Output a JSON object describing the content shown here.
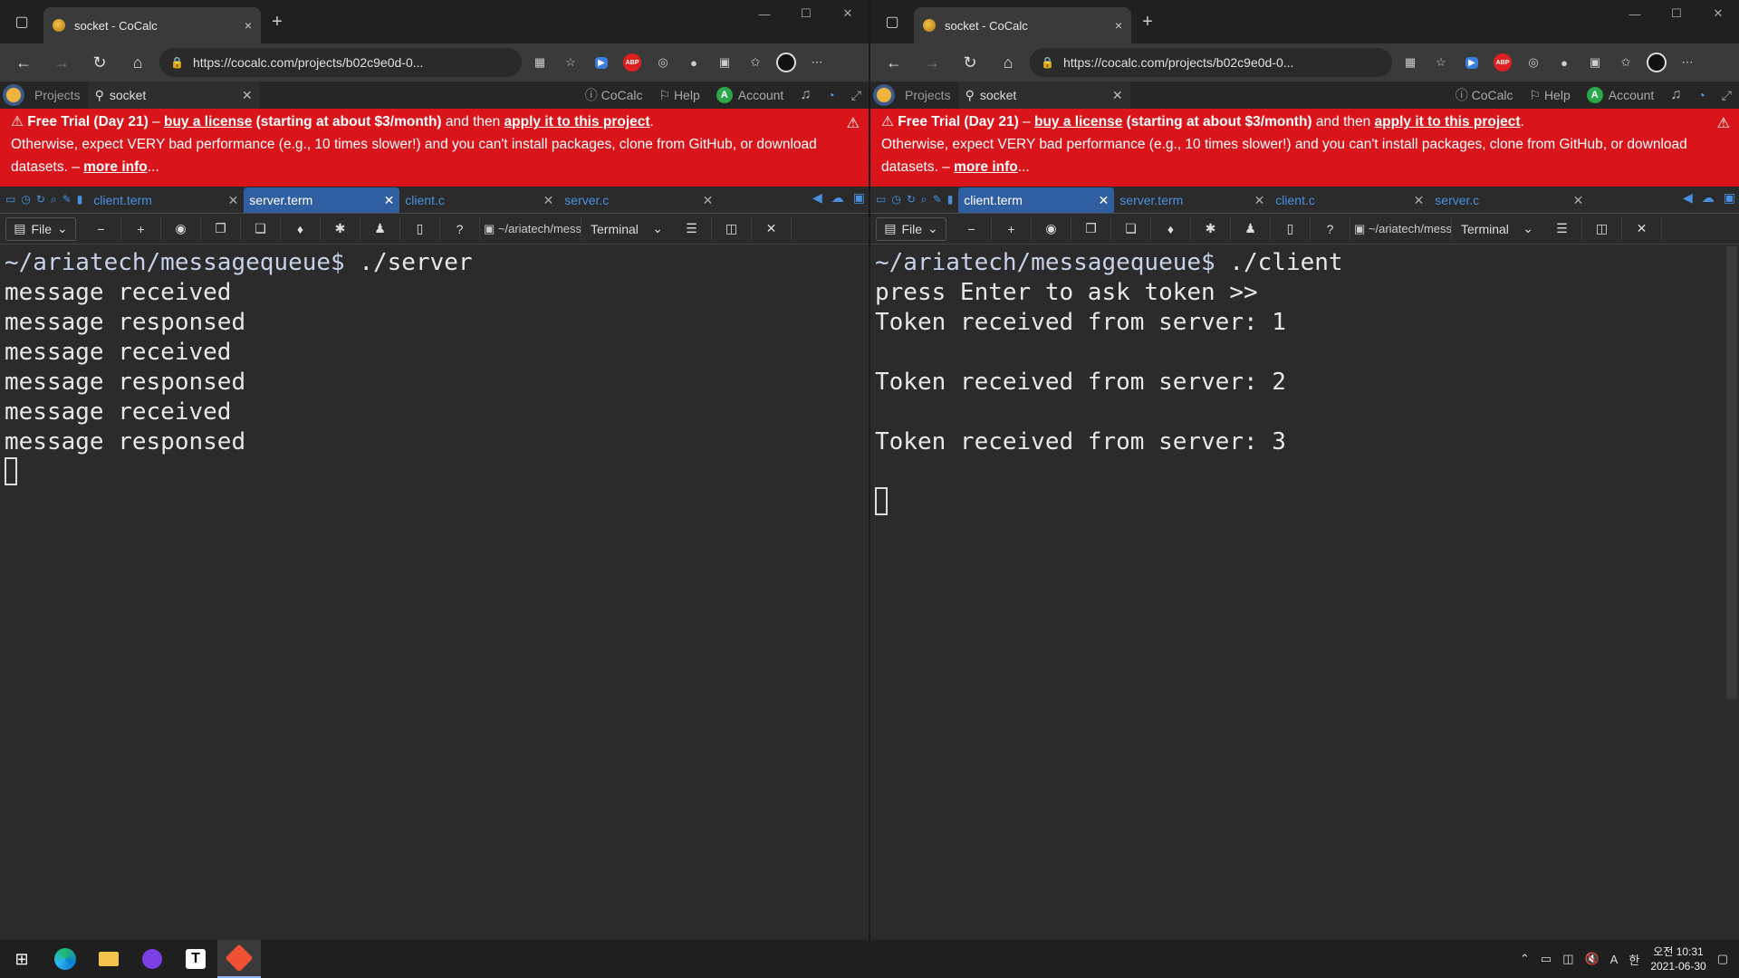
{
  "browser": {
    "tab_title": "socket - CoCalc",
    "close_glyph": "×",
    "new_tab_glyph": "+",
    "url": "https://cocalc.com/projects/b02c9e0d-0..."
  },
  "cocalc": {
    "projects_label": "Projects",
    "project_name": "socket",
    "cocalc_label": "CoCalc",
    "help_label": "Help",
    "account_label": "Account",
    "account_initial": "A"
  },
  "banner": {
    "lead": "Free Trial (Day 21)",
    "dash1": " – ",
    "buy_link": "buy a license",
    "price": " (starting at about $3/month)",
    "and_then": " and then ",
    "apply_link": "apply it to this project",
    "period": ".",
    "line2": "Otherwise, expect VERY bad performance (e.g., 10 times slower!) and you can't install packages, clone from GitHub, or download",
    "line3_prefix": "datasets. – ",
    "more_info": "more info",
    "ellipsis": "..."
  },
  "file_tabs": {
    "client_term": "client.term",
    "server_term": "server.term",
    "client_c": "client.c",
    "server_c": "server.c"
  },
  "toolbar": {
    "file_label": "File",
    "path": "~/ariatech/mess",
    "mode": "Terminal"
  },
  "left_terminal": {
    "prompt": "~/ariatech/messagequeue$",
    "command": " ./server",
    "lines": [
      "message received",
      "message responsed",
      "message received",
      "message responsed",
      "message received",
      "message responsed"
    ]
  },
  "right_terminal": {
    "prompt": "~/ariatech/messagequeue$",
    "command": " ./client",
    "line1": "press Enter to ask token >>",
    "line2": "Token received from server: 1",
    "line3": "Token received from server: 2",
    "line4": "Token received from server: 3"
  },
  "taskbar": {
    "typora_letter": "T",
    "ime_a": "A",
    "ime_han": "한",
    "time": "오전 10:31",
    "date": "2021-06-30"
  },
  "colors": {
    "banner_red": "#d9151b",
    "active_tab_blue": "#2f5fa0",
    "link_blue": "#4a90e2"
  }
}
